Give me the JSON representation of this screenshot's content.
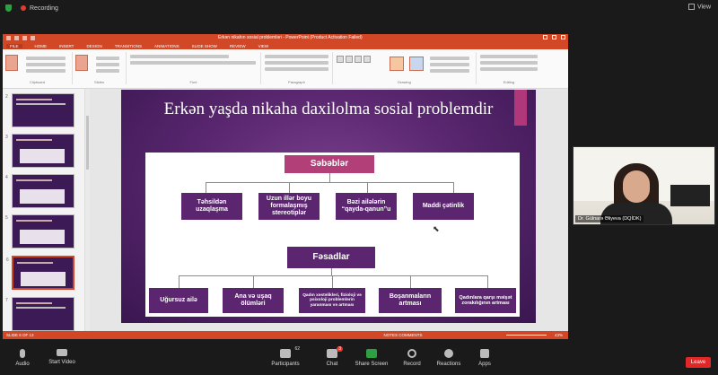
{
  "zoom_top": {
    "recording_label": "Recording",
    "view_label": "View"
  },
  "ppt": {
    "document_title": "Erkən nikahın sosial problemləri - PowerPoint (Product Activation Failed)",
    "tabs": [
      "FILE",
      "HOME",
      "INSERT",
      "DESIGN",
      "TRANSITIONS",
      "ANIMATIONS",
      "SLIDE SHOW",
      "REVIEW",
      "VIEW"
    ],
    "ribbon_groups": [
      "Clipboard",
      "Slides",
      "Font",
      "Paragraph",
      "Drawing",
      "Editing"
    ],
    "slide_numbers": [
      "2",
      "3",
      "4",
      "5",
      "6",
      "7"
    ],
    "status_left": "SLIDE 6 OF 13",
    "status_right": "NOTES  COMMENTS",
    "zoom_level": "43%"
  },
  "slide": {
    "title": "Erkən yaşda nikaha daxilolma sosial problemdir",
    "header_causes": "Səbəblər",
    "causes": [
      "Təhsildən uzaqlaşma",
      "Uzun illər boyu formalaşmış stereotiplər",
      "Bəzi ailələrin “qayda-qanun”u",
      "Maddi çətinlik"
    ],
    "header_consequences": "Fəsadlar",
    "consequences": [
      "Uğursuz ailə",
      "Ana və uşaq ölümləri",
      "Qadın xəstəlikləri, fizioloji və psixoloji problemlərin yaranması və artması",
      "Boşanmaların artması",
      "Qadınlara qarşı məişət zorakılığının artması"
    ]
  },
  "video": {
    "participant_name": "Dr. Gülnarə Əliyeva (DQİDK)"
  },
  "toolbar": {
    "audio_label": "Audio",
    "video_label": "Start Video",
    "participants_label": "Participants",
    "participants_count": "62",
    "chat_label": "Chat",
    "chat_badge": "3",
    "share_label": "Share Screen",
    "record_label": "Record",
    "reactions_label": "Reactions",
    "apps_label": "Apps",
    "leave_label": "Leave"
  },
  "colors": {
    "ppt_accent": "#d24726",
    "slide_purple": "#5b2570",
    "header_pink": "#b23f77",
    "share_green": "#2ea043",
    "leave_red": "#e02828"
  }
}
